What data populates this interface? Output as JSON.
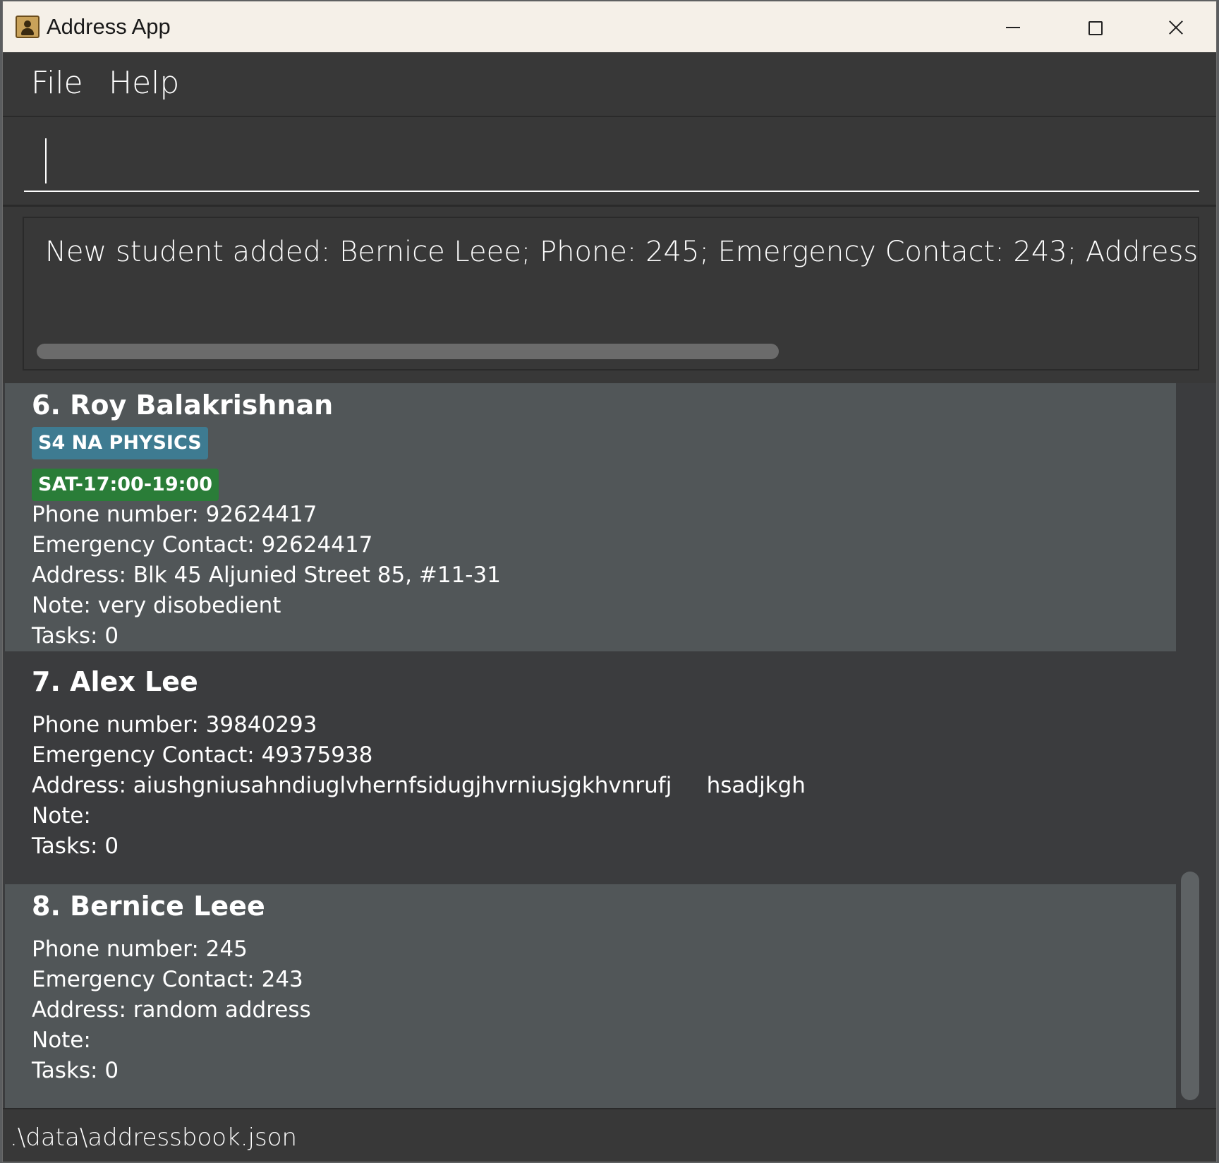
{
  "window": {
    "title": "Address App"
  },
  "menu": {
    "file": "File",
    "help": "Help"
  },
  "command": {
    "value": "",
    "placeholder": ""
  },
  "result": {
    "message": "New student added: Bernice Leee; Phone: 245; Emergency Contact: 243; Address: random"
  },
  "students": [
    {
      "name": "6. Roy Balakrishnan",
      "tags": [
        "S4 NA PHYSICS",
        "SAT-17:00-19:00"
      ],
      "phone": "Phone number: 92624417",
      "emergency": "Emergency Contact: 92624417",
      "address": "Address: Blk 45 Aljunied Street 85, #11-31",
      "note": "Note: very disobedient",
      "tasks": "Tasks: 0"
    },
    {
      "name": "7. Alex Lee",
      "tags": [],
      "phone": "Phone number: 39840293",
      "emergency": "Emergency Contact: 49375938",
      "address": "Address: aiushgniusahndiuglvhernfsidugjhvrniusjgkhvnrufj     hsadjkgh",
      "note": "Note:",
      "tasks": "Tasks: 0"
    },
    {
      "name": "8. Bernice Leee",
      "tags": [],
      "phone": "Phone number: 245",
      "emergency": "Emergency Contact: 243",
      "address": "Address: random address",
      "note": "Note:",
      "tasks": "Tasks: 0"
    }
  ],
  "status": {
    "file_path": ".\\data\\addressbook.json"
  },
  "colors": {
    "subject_tag": "#3e7b91",
    "time_tag": "#2a7d38",
    "card_light": "#515658",
    "card_dark": "#3b3c3e",
    "background": "#383838"
  }
}
